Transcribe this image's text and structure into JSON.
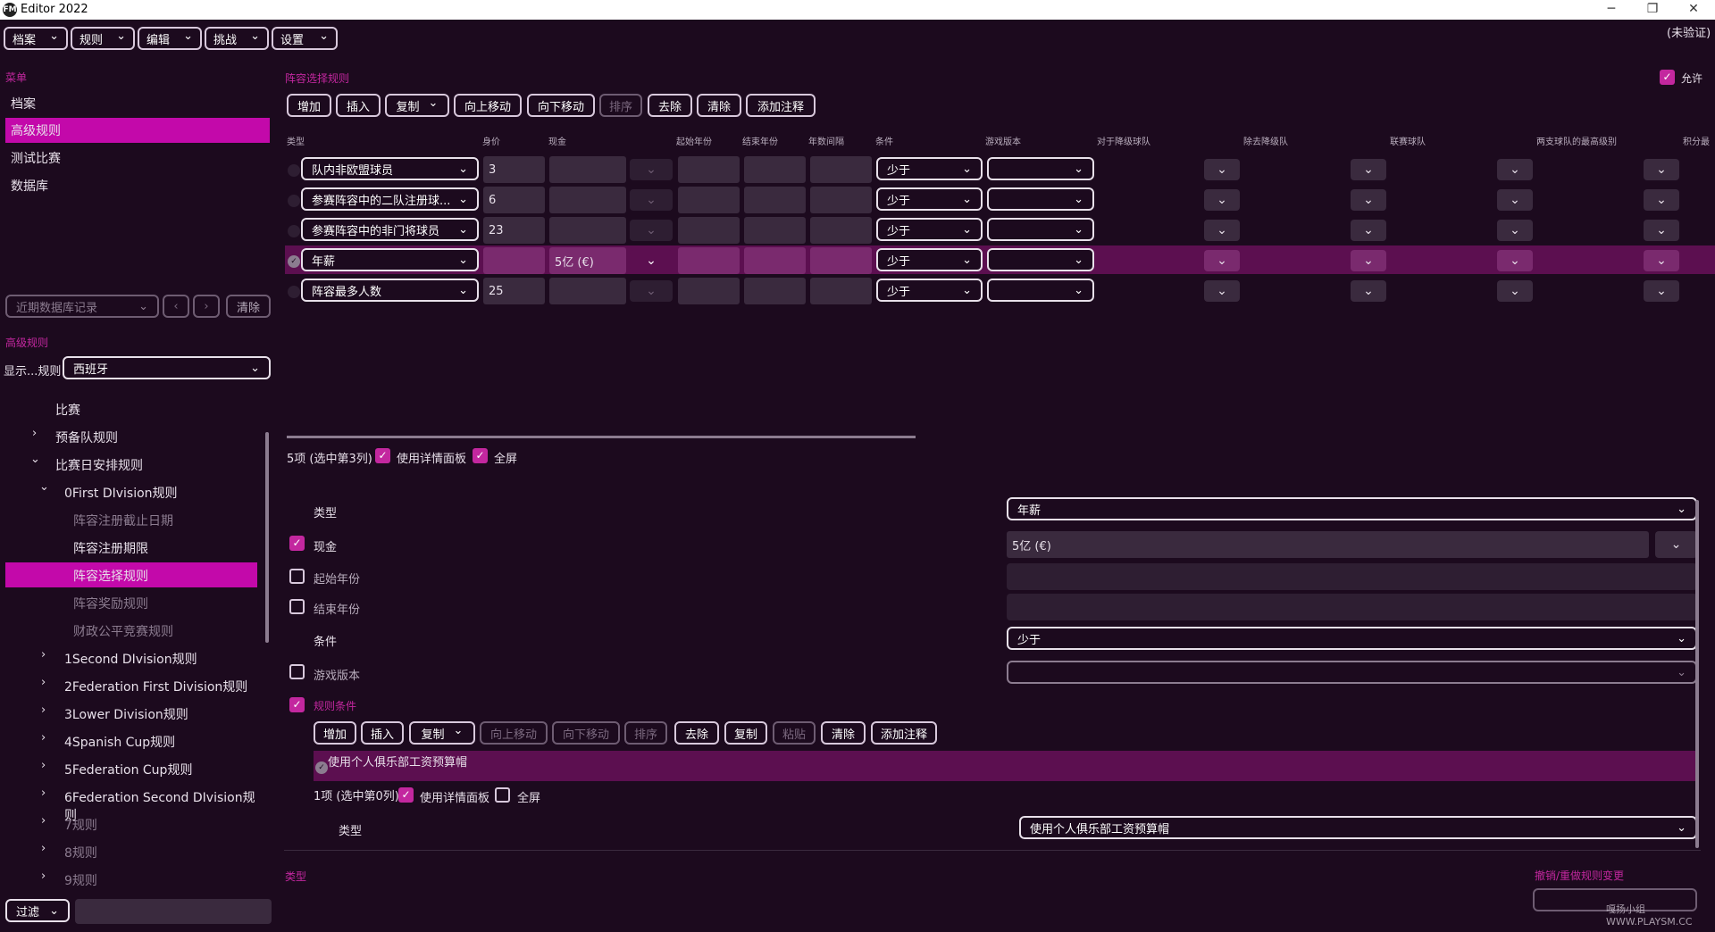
{
  "window": {
    "title": "Editor 2022",
    "logo": "FM"
  },
  "menubar": [
    "档案",
    "规则",
    "编辑",
    "挑战",
    "设置"
  ],
  "verify_status": "(未验证)",
  "sidebar": {
    "menu_label": "菜单",
    "items": [
      "档案",
      "高级规则",
      "测试比赛",
      "数据库"
    ],
    "recent_placeholder": "近期数据库记录",
    "clear": "清除",
    "adv_label": "高级规则",
    "display_label": "显示...规则",
    "nation": "西班牙",
    "tree": [
      "比赛",
      "预备队规则",
      "比赛日安排规则",
      "0First DIvision规则",
      "阵容注册截止日期",
      "阵容注册期限",
      "阵容选择规则",
      "阵容奖励规则",
      "财政公平竞赛规则",
      "1Second DIvision规则",
      "2Federation First Division规则",
      "3Lower Division规则",
      "4Spanish Cup规则",
      "5Federation Cup规则",
      "6Federation Second DIvision规则",
      "7规则",
      "8规则",
      "9规则"
    ],
    "filter": "过滤"
  },
  "main": {
    "section_title": "阵容选择规则",
    "allow": "允许",
    "toolbar": [
      "增加",
      "插入",
      "复制",
      "向上移动",
      "向下移动",
      "排序",
      "去除",
      "清除",
      "添加注释"
    ],
    "columns": [
      "类型",
      "身价",
      "现金",
      "起始年份",
      "结束年份",
      "年数间隔",
      "条件",
      "游戏版本",
      "对于降级球队",
      "除去降级队",
      "联赛球队",
      "两支球队的最高级别",
      "积分最"
    ],
    "rows": [
      {
        "type": "队内非欧盟球员",
        "value": "3",
        "cash": "",
        "cond": "少于"
      },
      {
        "type": "参赛阵容中的二队注册球...",
        "value": "6",
        "cash": "",
        "cond": "少于"
      },
      {
        "type": "参赛阵容中的非门将球员",
        "value": "23",
        "cash": "",
        "cond": "少于"
      },
      {
        "type": "年薪",
        "value": "",
        "cash": "5亿 (€)",
        "cond": "少于"
      },
      {
        "type": "阵容最多人数",
        "value": "25",
        "cash": "",
        "cond": "少于"
      }
    ],
    "summary": "5项 (选中第3列)",
    "use_detail": "使用详情面板",
    "fullscreen": "全屏",
    "detail": {
      "type_label": "类型",
      "type_value": "年薪",
      "cash_label": "现金",
      "cash_value": "5亿 (€)",
      "start_label": "起始年份",
      "end_label": "结束年份",
      "cond_label": "条件",
      "cond_value": "少于",
      "version_label": "游戏版本",
      "rule_cond_label": "规则条件"
    },
    "sub_toolbar": [
      "增加",
      "插入",
      "复制",
      "向上移动",
      "向下移动",
      "排序",
      "去除",
      "复制",
      "粘贴",
      "清除",
      "添加注释"
    ],
    "sub_row": "使用个人俱乐部工资预算帽",
    "sub_summary": "1项 (选中第0列)",
    "sub_type_label": "类型",
    "sub_type_value": "使用个人俱乐部工资预算帽",
    "bottom_type": "类型",
    "undo_label": "撤销/重做规则变更",
    "watermark": "嘎扬小组 WWW.PLAYSM.CC"
  },
  "colors": {
    "bg": "#1c0a1e",
    "accent": "#c309aa",
    "selected_row": "#5c0f50"
  }
}
